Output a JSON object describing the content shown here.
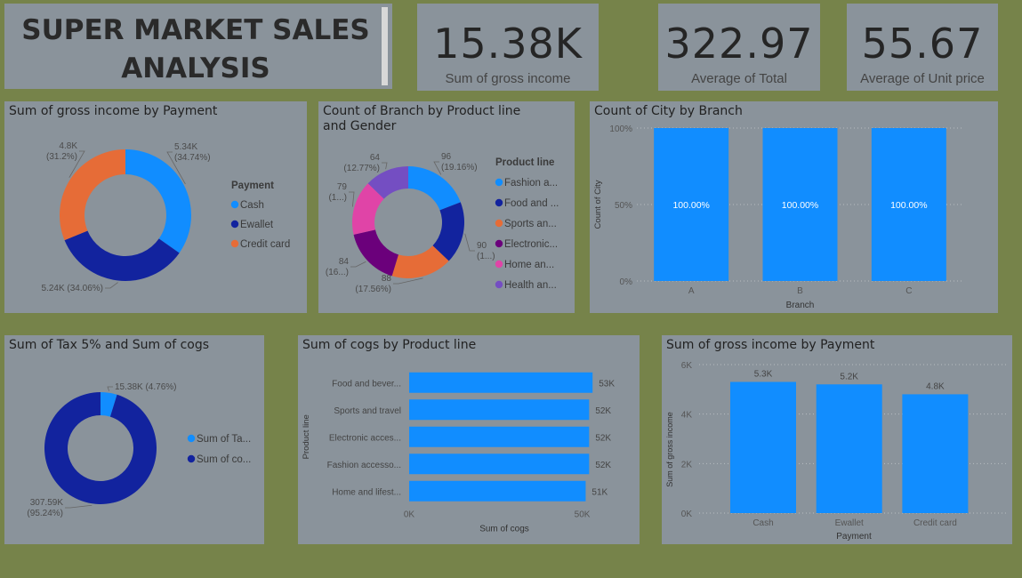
{
  "header": {
    "title_line1": "SUPER MARKET SALES",
    "title_line2": "ANALYSIS"
  },
  "kpis": [
    {
      "value": "15.38K",
      "label": "Sum of gross income"
    },
    {
      "value": "322.97",
      "label": "Average of Total"
    },
    {
      "value": "55.67",
      "label": "Average of Unit price"
    }
  ],
  "colors": {
    "background": "#76834a",
    "card": "#8a939b",
    "light_blue": "#118dff",
    "dark_blue": "#12239e",
    "orange": "#e66c37",
    "purple": "#6b007b",
    "pink": "#e044a7",
    "violet": "#744ec2"
  },
  "chart_data": [
    {
      "type": "pie",
      "title": "Sum of gross income by Payment",
      "legend_title": "Payment",
      "legend_position": "right",
      "categories": [
        "Cash",
        "Ewallet",
        "Credit card"
      ],
      "values": [
        5340,
        5240,
        4800
      ],
      "value_labels": [
        "5.34K",
        "5.24K",
        "4.8K"
      ],
      "percent_labels": [
        "(34.74%)",
        "(34.06%)",
        "(31.2%)"
      ],
      "colors": [
        "#118dff",
        "#12239e",
        "#e66c37"
      ]
    },
    {
      "type": "pie",
      "title": "Count of Branch by Product line and Gender",
      "legend_title": "Product line",
      "legend_position": "right",
      "categories": [
        "Fashion a...",
        "Food and ...",
        "Sports an...",
        "Electronic...",
        "Home an...",
        "Health an..."
      ],
      "values": [
        96,
        90,
        88,
        84,
        79,
        64
      ],
      "value_labels": [
        "96",
        "90",
        "88",
        "84",
        "79",
        "64"
      ],
      "percent_labels": [
        "(19.16%)",
        "(1...)",
        "(17.56%)",
        "(16...)",
        "(1...)",
        "(12.77%)"
      ],
      "colors": [
        "#118dff",
        "#12239e",
        "#e66c37",
        "#6b007b",
        "#e044a7",
        "#744ec2"
      ]
    },
    {
      "type": "bar",
      "title": "Count of City by Branch",
      "categories": [
        "A",
        "B",
        "C"
      ],
      "values": [
        100,
        100,
        100
      ],
      "data_labels": [
        "100.00%",
        "100.00%",
        "100.00%"
      ],
      "xlabel": "Branch",
      "ylabel": "Count of City",
      "ylim": [
        0,
        100
      ],
      "y_ticks": [
        "0%",
        "50%",
        "100%"
      ],
      "y_tick_values": [
        0,
        50,
        100
      ],
      "grid": true,
      "color": "#118dff"
    },
    {
      "type": "pie",
      "title": "Sum of Tax 5% and Sum of cogs",
      "legend_position": "right",
      "categories": [
        "Sum of Ta...",
        "Sum of co..."
      ],
      "values": [
        15380,
        307590
      ],
      "value_labels": [
        "15.38K",
        "307.59K"
      ],
      "percent_labels": [
        "(4.76%)",
        "(95.24%)"
      ],
      "colors": [
        "#118dff",
        "#12239e"
      ]
    },
    {
      "type": "bar",
      "orientation": "horizontal",
      "title": "Sum of cogs by Product line",
      "categories": [
        "Food and bever...",
        "Sports and travel",
        "Electronic acces...",
        "Fashion accesso...",
        "Home and lifest..."
      ],
      "values": [
        53000,
        52000,
        52000,
        52000,
        51000
      ],
      "data_labels": [
        "53K",
        "52K",
        "52K",
        "52K",
        "51K"
      ],
      "xlabel": "Sum of cogs",
      "ylabel": "Product line",
      "xlim": [
        0,
        55000
      ],
      "x_ticks": [
        "0K",
        "50K"
      ],
      "x_tick_values": [
        0,
        50000
      ],
      "color": "#118dff"
    },
    {
      "type": "bar",
      "title": "Sum of gross income by Payment",
      "categories": [
        "Cash",
        "Ewallet",
        "Credit card"
      ],
      "values": [
        5300,
        5200,
        4800
      ],
      "data_labels": [
        "5.3K",
        "5.2K",
        "4.8K"
      ],
      "xlabel": "Payment",
      "ylabel": "Sum of gross income",
      "ylim": [
        0,
        6000
      ],
      "y_ticks": [
        "0K",
        "2K",
        "4K",
        "6K"
      ],
      "y_tick_values": [
        0,
        2000,
        4000,
        6000
      ],
      "grid": true,
      "color": "#118dff"
    }
  ]
}
